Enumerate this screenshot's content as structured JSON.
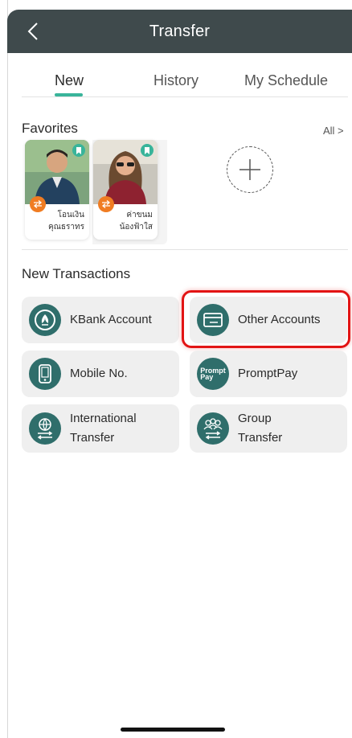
{
  "header": {
    "title": "Transfer"
  },
  "tabs": [
    {
      "label": "New"
    },
    {
      "label": "History"
    },
    {
      "label": "My Schedule"
    }
  ],
  "favorites": {
    "title": "Favorites",
    "all_label": "All >",
    "items": [
      {
        "line1": "โอนเงิน",
        "line2": "คุณธราทร"
      },
      {
        "line1": "ค่าขนม",
        "line2": "น้องฟ้าใส"
      }
    ]
  },
  "new_transactions": {
    "title": "New Transactions",
    "items": [
      {
        "line1": "KBank Account",
        "line2": ""
      },
      {
        "line1": "Other Accounts",
        "line2": ""
      },
      {
        "line1": "Mobile No.",
        "line2": ""
      },
      {
        "line1": "PromptPay",
        "line2": ""
      },
      {
        "line1": "International",
        "line2": "Transfer"
      },
      {
        "line1": "Group",
        "line2": "Transfer"
      }
    ],
    "promptpay_icon_text": [
      "Prompt",
      "Pay"
    ]
  },
  "colors": {
    "header_bg": "#3f4a4c",
    "accent_green": "#39b49a",
    "icon_circle": "#2f6e6b",
    "swap_orange": "#f07c22",
    "highlight_red": "#e21414"
  },
  "icons": {
    "back": "chevron-left-icon",
    "bookmark": "bookmark-icon",
    "swap": "swap-arrows-icon",
    "add": "plus-icon"
  }
}
